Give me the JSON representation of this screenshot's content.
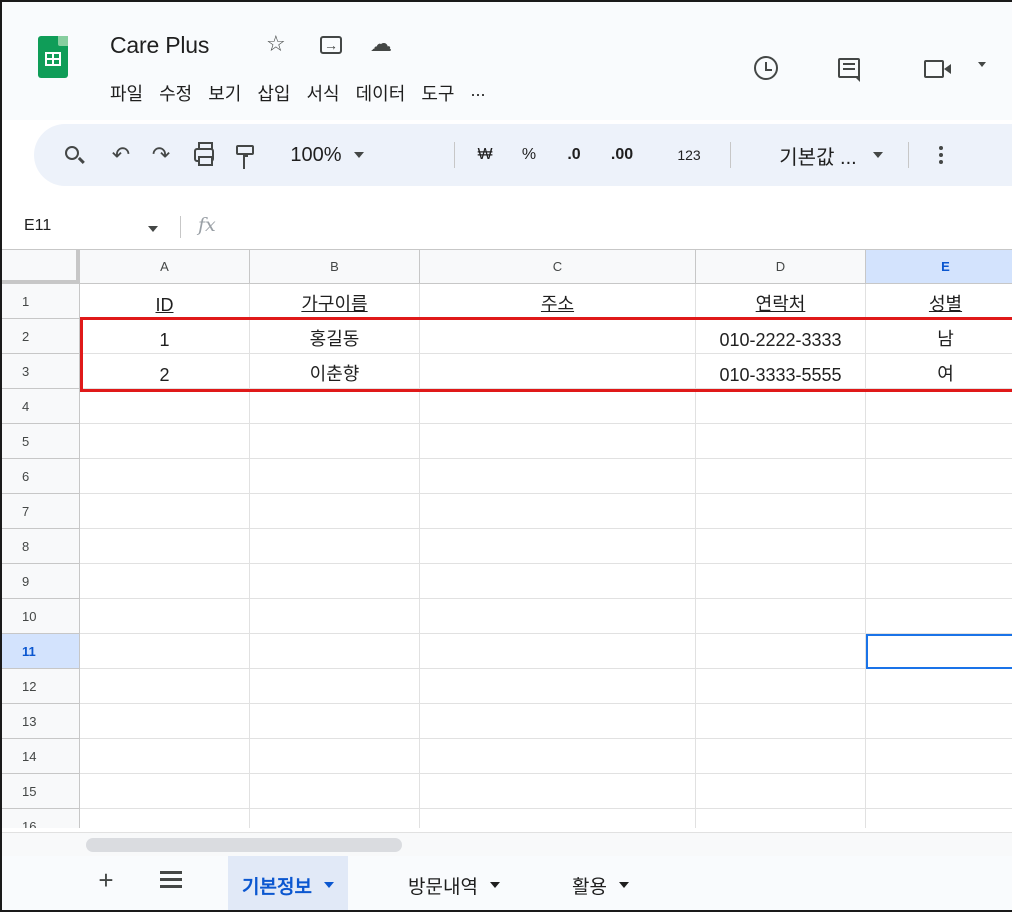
{
  "app": {
    "title": "Care Plus",
    "menu": [
      "파일",
      "수정",
      "보기",
      "삽입",
      "서식",
      "데이터",
      "도구",
      "..."
    ],
    "title_icons": [
      "star-icon",
      "move-to-folder-icon",
      "cloud-status-icon"
    ],
    "top_right_icons": [
      "version-history-icon",
      "comments-icon",
      "meet-icon"
    ]
  },
  "toolbar": {
    "zoom": "100%",
    "currency": "₩",
    "percent": "%",
    "decrease_decimal": ".0",
    "increase_decimal": ".00",
    "number_format": "123",
    "font": "기본값 ..."
  },
  "formula_bar": {
    "cell_ref": "E11",
    "fx": "fx",
    "value": ""
  },
  "sheet": {
    "columns": [
      "A",
      "B",
      "C",
      "D",
      "E"
    ],
    "rows": [
      "1",
      "2",
      "3",
      "4",
      "5",
      "6",
      "7",
      "8",
      "9",
      "10",
      "11",
      "12",
      "13",
      "14",
      "15",
      "16"
    ],
    "active_column": "E",
    "active_row": "11",
    "header_row": [
      "ID",
      "가구이름",
      "주소",
      "연락처",
      "성별"
    ],
    "data_rows": [
      [
        "1",
        "홍길동",
        "",
        "010-2222-3333",
        "남"
      ],
      [
        "2",
        "이춘향",
        "",
        "010-3333-5555",
        "여"
      ]
    ],
    "highlight_color": "#e01919",
    "selection_color": "#1a73e8"
  },
  "tabs": {
    "items": [
      {
        "label": "기본정보",
        "active": true
      },
      {
        "label": "방문내역",
        "active": false
      },
      {
        "label": "활용",
        "active": false
      }
    ]
  }
}
